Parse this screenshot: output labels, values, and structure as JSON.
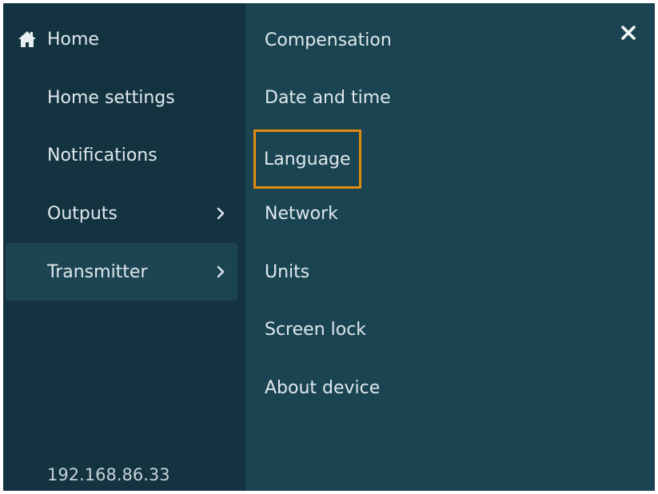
{
  "left_menu": {
    "items": [
      {
        "label": "Home",
        "icon": "home-icon"
      },
      {
        "label": "Home settings"
      },
      {
        "label": "Notifications"
      },
      {
        "label": "Outputs",
        "has_submenu": true
      },
      {
        "label": "Transmitter",
        "has_submenu": true,
        "active": true
      }
    ],
    "ip_address": "192.168.86.33"
  },
  "right_menu": {
    "items": [
      {
        "label": "Compensation"
      },
      {
        "label": "Date and time"
      },
      {
        "label": "Language",
        "focused": true
      },
      {
        "label": "Network"
      },
      {
        "label": "Units"
      },
      {
        "label": "Screen lock"
      },
      {
        "label": "About device"
      }
    ]
  },
  "colors": {
    "left_bg": "#133340",
    "right_bg": "#1b4452",
    "active_item_bg": "#1d4453",
    "focus_border": "#e08a10",
    "text": "#dfe8ec"
  },
  "icons": {
    "close": "close-icon",
    "submenu": "chevron-right-icon"
  }
}
